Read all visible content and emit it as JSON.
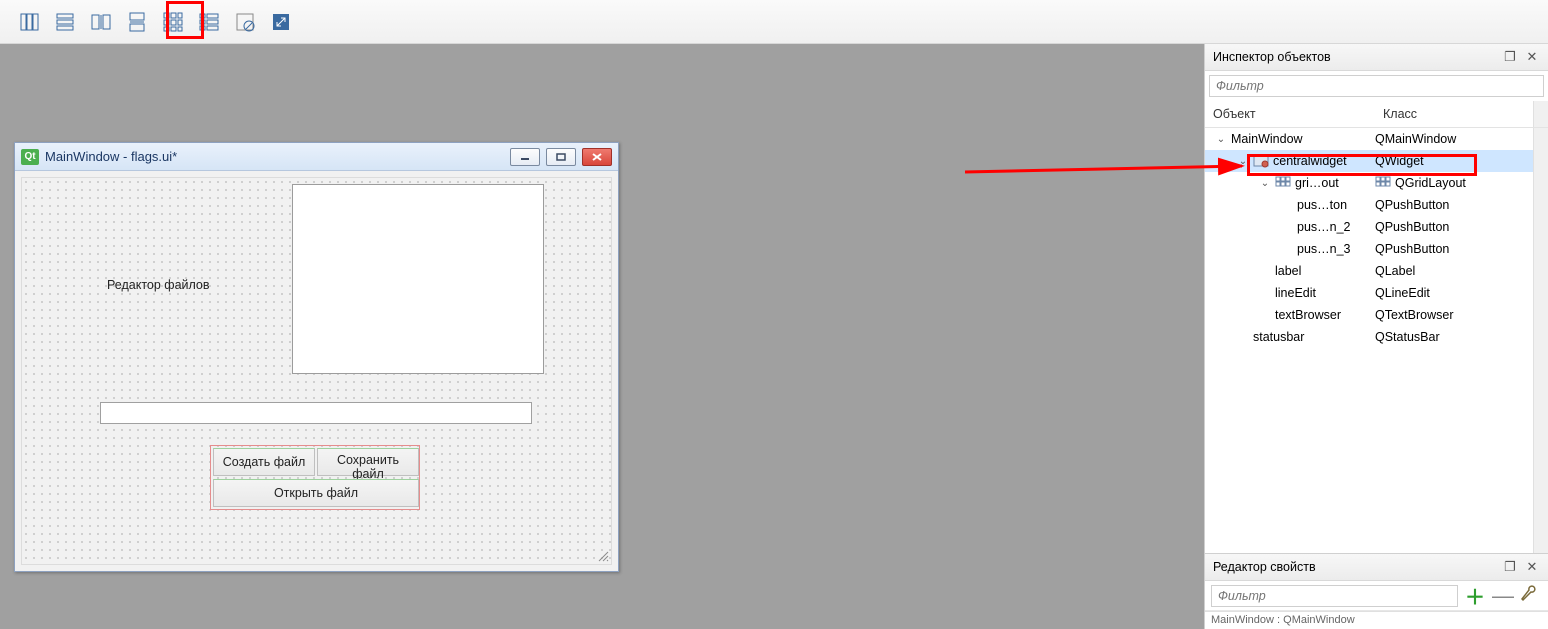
{
  "toolbar_icons": [
    "layout-vertical-icon",
    "layout-horizontal-icon",
    "layout-splith-icon",
    "layout-splitv-icon",
    "layout-grid-icon",
    "layout-form-icon",
    "break-layout-icon",
    "adjust-size-icon"
  ],
  "designer": {
    "qt_badge": "Qt",
    "window_title": "MainWindow - flags.ui*",
    "label_text": "Редактор файлов",
    "button1": "Создать файл",
    "button2": "Сохранить файл",
    "button3": "Открыть файл"
  },
  "inspector": {
    "title": "Инспектор объектов",
    "filter_placeholder": "Фильтр",
    "col_object": "Объект",
    "col_class": "Класс",
    "tree": [
      {
        "depth": 0,
        "exp": "open",
        "icon": "",
        "obj": "MainWindow",
        "kls": "QMainWindow",
        "sel": false
      },
      {
        "depth": 1,
        "exp": "open",
        "icon": "widget",
        "obj": "centralwidget",
        "kls": "QWidget",
        "sel": true
      },
      {
        "depth": 2,
        "exp": "open",
        "icon": "grid",
        "obj": "gri…out",
        "kls": "QGridLayout",
        "sel": false,
        "klsicon": "grid"
      },
      {
        "depth": 3,
        "exp": "",
        "icon": "",
        "obj": "pus…ton",
        "kls": "QPushButton",
        "sel": false
      },
      {
        "depth": 3,
        "exp": "",
        "icon": "",
        "obj": "pus…n_2",
        "kls": "QPushButton",
        "sel": false
      },
      {
        "depth": 3,
        "exp": "",
        "icon": "",
        "obj": "pus…n_3",
        "kls": "QPushButton",
        "sel": false
      },
      {
        "depth": 2,
        "exp": "",
        "icon": "",
        "obj": "label",
        "kls": "QLabel",
        "sel": false
      },
      {
        "depth": 2,
        "exp": "",
        "icon": "",
        "obj": "lineEdit",
        "kls": "QLineEdit",
        "sel": false
      },
      {
        "depth": 2,
        "exp": "",
        "icon": "",
        "obj": "textBrowser",
        "kls": "QTextBrowser",
        "sel": false
      },
      {
        "depth": 1,
        "exp": "",
        "icon": "",
        "obj": "statusbar",
        "kls": "QStatusBar",
        "sel": false
      }
    ]
  },
  "props": {
    "title": "Редактор свойств",
    "filter_placeholder": "Фильтр",
    "status": "MainWindow : QMainWindow"
  }
}
